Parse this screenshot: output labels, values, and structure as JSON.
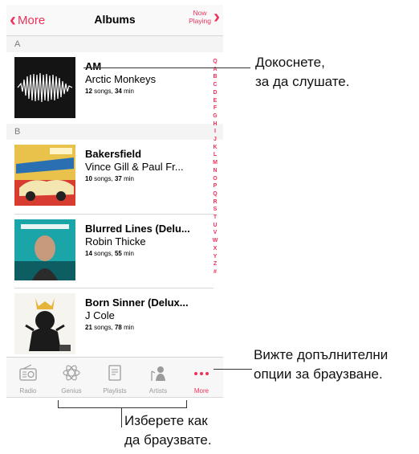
{
  "navbar": {
    "back_label": "More",
    "title": "Albums",
    "now_playing_line1": "Now",
    "now_playing_line2": "Playing"
  },
  "sections": [
    {
      "letter": "A"
    },
    {
      "letter": "B"
    }
  ],
  "albums": [
    {
      "title": "AM",
      "artist": "Arctic Monkeys",
      "songs": "12",
      "songs_unit": "songs,",
      "minutes": "34",
      "min_unit": "min"
    },
    {
      "title": "Bakersfield",
      "artist": "Vince Gill & Paul Fr...",
      "songs": "10",
      "songs_unit": "songs,",
      "minutes": "37",
      "min_unit": "min"
    },
    {
      "title": "Blurred Lines (Delu...",
      "artist": "Robin Thicke",
      "songs": "14",
      "songs_unit": "songs,",
      "minutes": "55",
      "min_unit": "min"
    },
    {
      "title": "Born Sinner (Delux...",
      "artist": "J Cole",
      "songs": "21",
      "songs_unit": "songs,",
      "minutes": "78",
      "min_unit": "min"
    }
  ],
  "index_letters": [
    "Q",
    "A",
    "B",
    "C",
    "D",
    "E",
    "F",
    "G",
    "H",
    "I",
    "J",
    "K",
    "L",
    "M",
    "N",
    "O",
    "P",
    "Q",
    "R",
    "S",
    "T",
    "U",
    "V",
    "W",
    "X",
    "Y",
    "Z",
    "#"
  ],
  "tabs": [
    {
      "label": "Radio",
      "icon": "radio-icon"
    },
    {
      "label": "Genius",
      "icon": "genius-icon"
    },
    {
      "label": "Playlists",
      "icon": "playlists-icon"
    },
    {
      "label": "Artists",
      "icon": "artists-icon"
    },
    {
      "label": "More",
      "icon": "more-icon"
    }
  ],
  "callouts": {
    "tap_line1": "Докоснете,",
    "tap_line2": "за да слушате.",
    "more_line1": "Вижте допълнителни",
    "more_line2": "опции за браузване.",
    "choose_line1": "Изберете как",
    "choose_line2": "да браузвате."
  },
  "colors": {
    "accent": "#f0315b",
    "tab_inactive": "#9b9b9b"
  }
}
